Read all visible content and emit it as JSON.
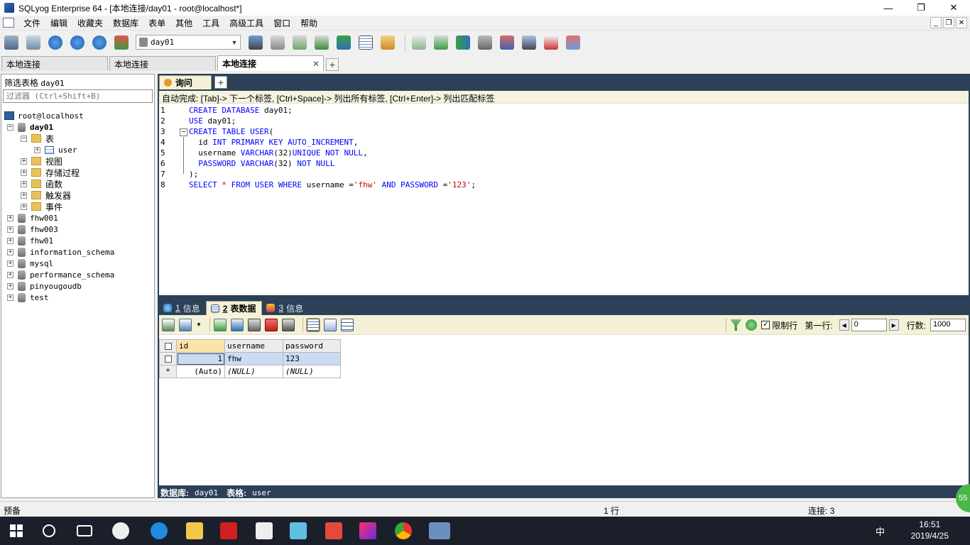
{
  "window": {
    "title": "SQLyog Enterprise 64 - [本地连接/day01 - root@localhost*]",
    "controls": [
      "—",
      "❐",
      "✕"
    ]
  },
  "menu": {
    "items": [
      "文件",
      "编辑",
      "收藏夹",
      "数据库",
      "表单",
      "其他",
      "工具",
      "高级工具",
      "窗口",
      "帮助"
    ]
  },
  "toolbar": {
    "database_select": "day01"
  },
  "connection_tabs": [
    {
      "label": "本地连接",
      "active": false
    },
    {
      "label": "本地连接",
      "active": false
    },
    {
      "label": "本地连接",
      "active": true
    }
  ],
  "object_browser": {
    "filter_label": "筛选表格",
    "filter_db": "day01",
    "filter_placeholder": "过滤器 (Ctrl+Shift+B)",
    "root": "root@localhost",
    "day01": "day01",
    "folders": {
      "tables": "表",
      "views": "视图",
      "procedures": "存储过程",
      "functions": "函数",
      "triggers": "触发器",
      "events": "事件"
    },
    "table_user": "user",
    "databases": [
      "fhw001",
      "fhw003",
      "fhw01",
      "information_schema",
      "mysql",
      "performance_schema",
      "pinyougoudb",
      "test"
    ]
  },
  "query_tab": {
    "label": "询问",
    "add": "+"
  },
  "autocomplete_hint": "自动完成: [Tab]-> 下一个标签, [Ctrl+Space]-> 列出所有标签, [Ctrl+Enter]-> 列出匹配标签",
  "editor": {
    "line_numbers": [
      "1",
      "2",
      "3",
      "4",
      "5",
      "6",
      "7",
      "8"
    ]
  },
  "result_tabs": [
    {
      "num": "1",
      "label": "信息",
      "active": false
    },
    {
      "num": "2",
      "label": "表数据",
      "active": true
    },
    {
      "num": "3",
      "label": "信息",
      "active": false
    }
  ],
  "result_toolbar": {
    "limit_rows_label": "限制行",
    "limit_checked": true,
    "first_row_label": "第一行:",
    "first_row_value": "0",
    "row_count_label": "行数:",
    "row_count_value": "1000"
  },
  "grid": {
    "columns": [
      "id",
      "username",
      "password"
    ],
    "row1": {
      "id": "1",
      "username": "fhw",
      "password": "123"
    },
    "new_row": {
      "marker": "*",
      "id": "(Auto)",
      "username": "(NULL)",
      "password": "(NULL)"
    }
  },
  "info_bar": {
    "db_label": "数据库:",
    "db_value": "day01",
    "table_label": "表格:",
    "table_value": "user"
  },
  "status_bar": {
    "left": "预备",
    "middle": "1 行",
    "right": "连接: 3"
  },
  "taskbar": {
    "time": "16:51",
    "date": "2019/4/25",
    "ime": "中",
    "badge": "55"
  }
}
